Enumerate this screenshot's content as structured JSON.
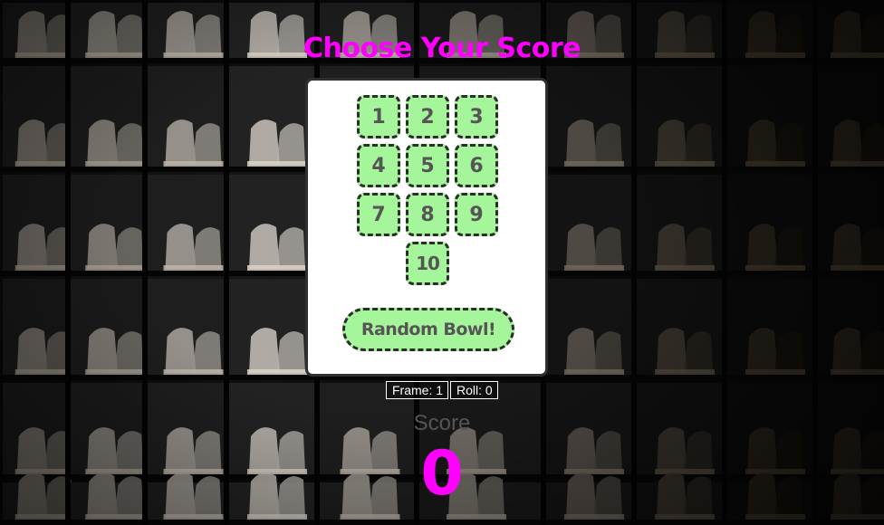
{
  "title": "Choose Your Score",
  "pins": {
    "buttons": [
      "1",
      "2",
      "3",
      "4",
      "5",
      "6",
      "7",
      "8",
      "9",
      "10"
    ],
    "random_label": "Random Bowl!"
  },
  "status": {
    "frame": "Frame: 1",
    "roll": "Roll: 0"
  },
  "score": {
    "label": "Score",
    "value": "0"
  },
  "colors": {
    "accent": "#ff00ff",
    "button_fill": "#a5f59a",
    "button_text": "#555555",
    "button_border": "#2d2d2d",
    "card_bg": "#ffffff"
  }
}
